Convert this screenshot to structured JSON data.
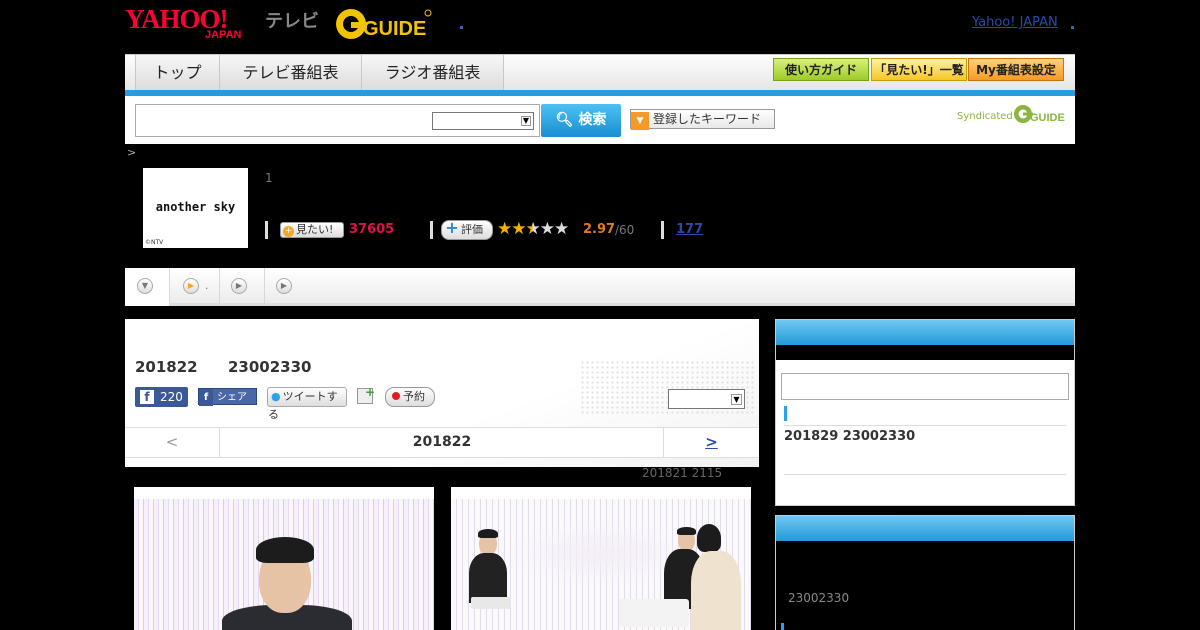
{
  "header": {
    "logo_yahoo": "YAHOO!",
    "logo_japan": "JAPAN",
    "tv_label": "テレビ",
    "gguide_label": "GUIDE",
    "yahoo_japan_link": "Yahoo! JAPAN"
  },
  "nav": {
    "tabs": [
      {
        "label": "トップ"
      },
      {
        "label": "テレビ番組表"
      },
      {
        "label": "ラジオ番組表"
      }
    ],
    "guide_label": "使い方ガイド",
    "mitai_list_label": "「見たい!」一覧",
    "my_schedule_label": "My番組表設定"
  },
  "search": {
    "input_value": "",
    "select_value": "",
    "button_label": "検索",
    "keyword_button_label": "登録したキーワード",
    "syndicated_label": "Syndicated",
    "syndicated_logo": "GUIDE"
  },
  "breadcrumb": ">",
  "program": {
    "thumb_title": "another sky",
    "thumb_copyright": "©NTV",
    "number": "1",
    "mitai_label": "見たい!",
    "mitai_count": "37605",
    "hyouka_label": "評価",
    "stars_filled": "★★",
    "stars_half": "★",
    "stars_empty": "★★",
    "rating": "2.97",
    "rating_max": "/60",
    "review_count": "177"
  },
  "subtabs": {
    "tab2_label": "."
  },
  "episode": {
    "air_date": "201822",
    "air_time": "23002330",
    "fb_count": "220",
    "fb_share_label": "シェア",
    "tweet_label": "ツイートする",
    "yoyaku_label": "予約",
    "select_value": "",
    "nav_prev": "<",
    "nav_date": "201822",
    "nav_next": ">",
    "updated": "201821  2115"
  },
  "sidebar": {
    "next_air": "201829  23002330",
    "box2_time": "23002330"
  },
  "colors": {
    "accent_blue": "#2a9bd6",
    "mitai_count": "#e0104a",
    "rating": "#e07b1a",
    "link": "#2a4aa8"
  }
}
